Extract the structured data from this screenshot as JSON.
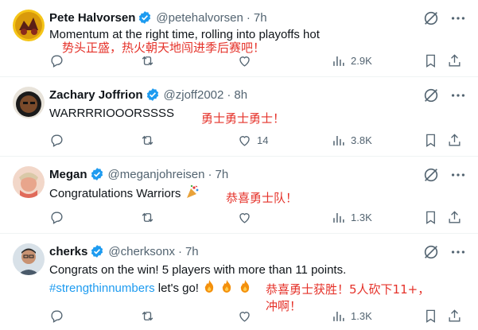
{
  "posts": [
    {
      "name": "Pete Halvorsen",
      "handle": "@petehalvorsen",
      "time": "7h",
      "text": "Momentum at the right time, rolling into playoffs hot",
      "translation": "势头正盛，热火朝天地闯进季后赛吧！",
      "replies": "",
      "reposts": "",
      "likes": "",
      "views": "2.9K",
      "avatar_color": "#f5c518"
    },
    {
      "name": "Zachary Joffrion",
      "handle": "@zjoff2002",
      "time": "8h",
      "text": "WARRRRIOOORSSSS",
      "translation": "勇士勇士勇士！",
      "replies": "",
      "reposts": "",
      "likes": "14",
      "views": "3.8K",
      "avatar_color": "#1a1a1a"
    },
    {
      "name": "Megan",
      "handle": "@meganjohreisen",
      "time": "7h",
      "text": "Congratulations Warriors",
      "translation": "恭喜勇士队！",
      "replies": "",
      "reposts": "",
      "likes": "",
      "views": "1.3K",
      "avatar_color": "#e7a9a0"
    },
    {
      "name": "cherks",
      "handle": "@cherksonx",
      "time": "7h",
      "text_line1": "Congrats on the win! 5 players with more than 11 points.",
      "hashtag": "#strengthinnumbers",
      "text_line2_rest": "let's go!",
      "translation_line1": "恭喜勇士获胜！5人砍下11+，",
      "translation_line2": "冲啊！",
      "replies": "",
      "reposts": "",
      "likes": "",
      "views": "1.3K",
      "avatar_color": "#c9d4dc"
    }
  ],
  "icons": {
    "verified": "verified-badge-icon",
    "grok": "grok-icon",
    "more": "more-icon",
    "reply": "reply-icon",
    "repost": "repost-icon",
    "like": "heart-icon",
    "views": "views-icon",
    "bookmark": "bookmark-icon",
    "share": "share-icon",
    "fire": "fire-emoji",
    "confetti": "confetti-emoji"
  },
  "colors": {
    "verified": "#1d9bf0",
    "hashtag": "#1d9bf0",
    "translation": "#e5322a",
    "muted": "#536471"
  }
}
